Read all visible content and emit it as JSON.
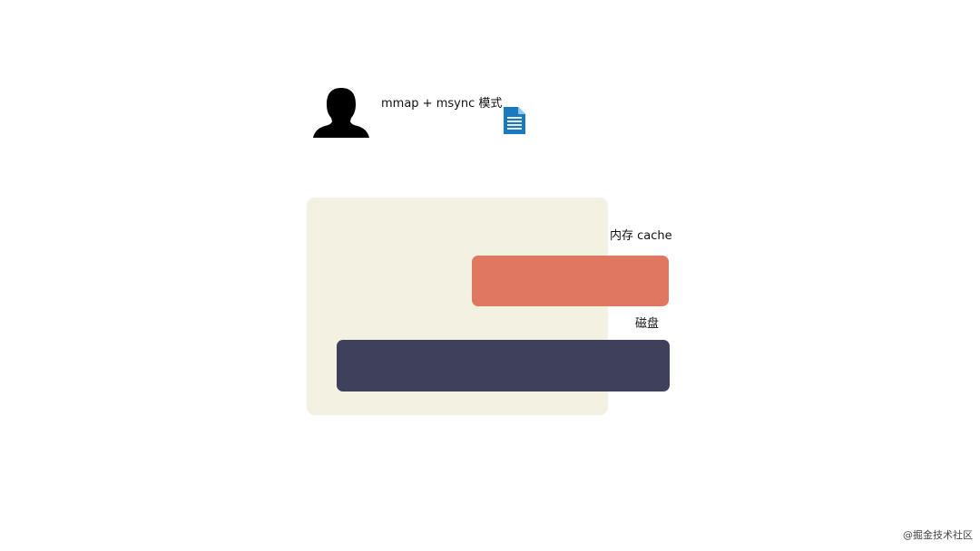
{
  "diagram": {
    "mode_label": "mmap + msync 模式",
    "cache_label": "内存 cache",
    "disk_label": "磁盘",
    "icons": {
      "user": "user-silhouette-icon",
      "file": "document-icon"
    }
  },
  "watermark": "@掘金技术社区",
  "colors": {
    "process_area": "#f3f1e1",
    "cache": "#e07861",
    "disk": "#3f405c",
    "file_icon": "#1a7abf",
    "silhouette": "#000000"
  }
}
